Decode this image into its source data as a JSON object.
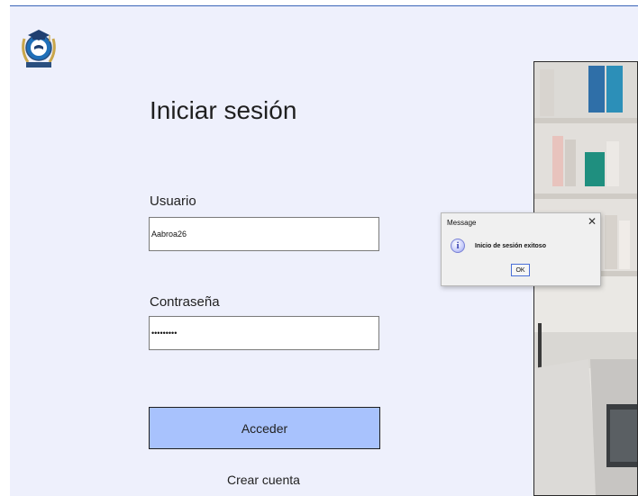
{
  "login": {
    "title": "Iniciar sesión",
    "username_label": "Usuario",
    "username_value": "Aabroa26",
    "password_label": "Contraseña",
    "password_value": "•••••••••",
    "submit_label": "Acceder",
    "create_account_label": "Crear cuenta"
  },
  "dialog": {
    "title": "Message",
    "close_glyph": "✕",
    "icon_glyph": "i",
    "message": "Inicio de sesión exitoso",
    "ok_label": "OK"
  },
  "colors": {
    "background": "#eef0fc",
    "accent_button": "#a8c2fd",
    "top_border": "#3a64b8"
  },
  "icons": {
    "logo": "graduation-cap-laurel-logo-icon",
    "dialog": "information-icon"
  }
}
